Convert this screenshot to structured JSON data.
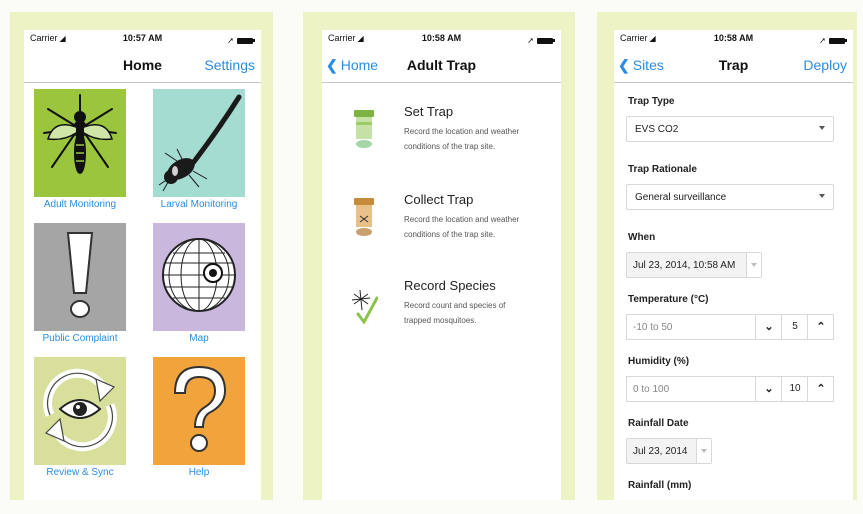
{
  "status": {
    "carrier": "Carrier",
    "times": [
      "10:57 AM",
      "10:58 AM",
      "10:58 AM"
    ]
  },
  "home": {
    "title": "Home",
    "settings": "Settings",
    "tiles": [
      {
        "label": "Adult Monitoring",
        "icon": "mosquito-icon",
        "color": "#9bc53d"
      },
      {
        "label": "Larval Monitoring",
        "icon": "larva-icon",
        "color": "#a5dcd2"
      },
      {
        "label": "Public Complaint",
        "icon": "exclamation-icon",
        "color": "#a5a5a5"
      },
      {
        "label": "Map",
        "icon": "globe-icon",
        "color": "#c9b7de"
      },
      {
        "label": "Review & Sync",
        "icon": "sync-eye-icon",
        "color": "#d7df9b"
      },
      {
        "label": "Help",
        "icon": "question-icon",
        "color": "#f0a43b"
      }
    ]
  },
  "adult_trap": {
    "back": "Home",
    "title": "Adult Trap",
    "items": [
      {
        "heading": "Set Trap",
        "desc": "Record the location and weather conditions of the trap site."
      },
      {
        "heading": "Collect Trap",
        "desc": "Record the location and weather conditions of the trap site."
      },
      {
        "heading": "Record Species",
        "desc": "Record count and species of trapped mosquitoes."
      }
    ]
  },
  "trap": {
    "back": "Sites",
    "title": "Trap",
    "action": "Deploy",
    "trap_type_label": "Trap Type",
    "trap_type_value": "EVS CO2",
    "rationale_label": "Trap Rationale",
    "rationale_value": "General surveillance",
    "when_label": "When",
    "when_value": "Jul 23, 2014, 10:58 AM",
    "temp_label": "Temperature (°C)",
    "temp_placeholder": "-10 to 50",
    "temp_value": "5",
    "humidity_label": "Humidity (%)",
    "humidity_placeholder": "0 to 100",
    "humidity_value": "10",
    "rain_date_label": "Rainfall Date",
    "rain_date_value": "Jul 23, 2014",
    "rainfall_label": "Rainfall (mm)"
  }
}
